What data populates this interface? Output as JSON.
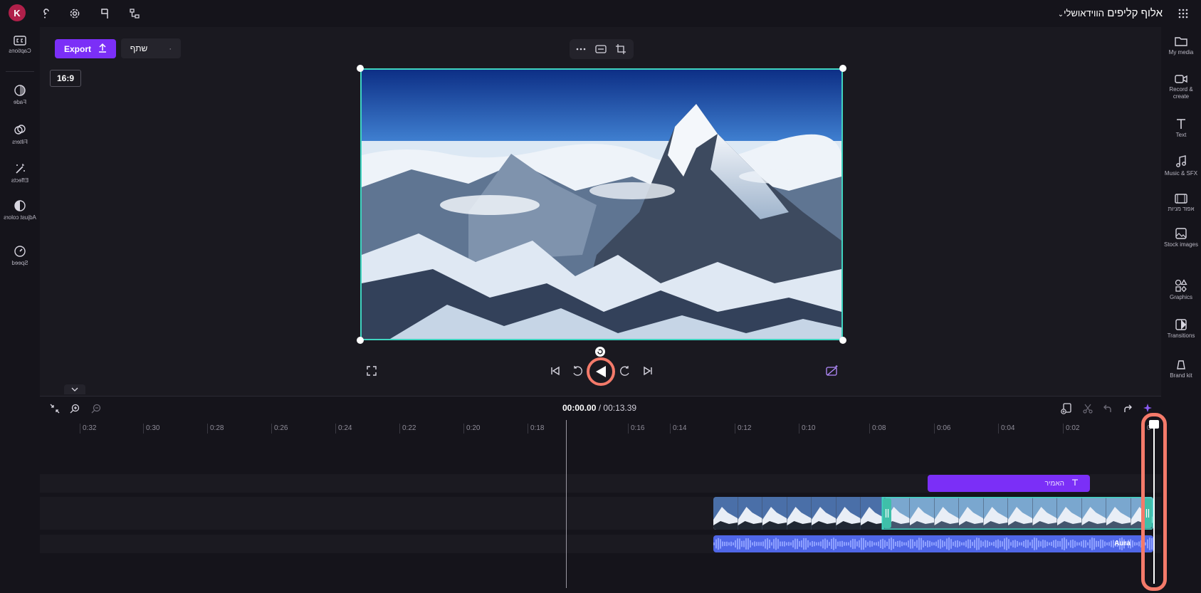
{
  "header": {
    "title": "אלוף קליפים",
    "library_label": "הווידאושלי",
    "avatar_initial": "K"
  },
  "left_rail": [
    {
      "label": "Captions",
      "icon": "captions-icon"
    },
    {
      "label": "Fade",
      "icon": "fade-icon"
    },
    {
      "label": "Filters",
      "icon": "filters-icon"
    },
    {
      "label": "Effects",
      "icon": "effects-icon"
    },
    {
      "label": "Adjust colors",
      "icon": "adjust-colors-icon"
    },
    {
      "label": "Speed",
      "icon": "speed-icon"
    }
  ],
  "right_rail": [
    {
      "label": "My media",
      "icon": "folder-icon"
    },
    {
      "label": "Record & create",
      "icon": "camera-icon"
    },
    {
      "label": "Text",
      "icon": "text-icon"
    },
    {
      "label": "Music & SFX",
      "icon": "music-icon"
    },
    {
      "label": "אפוד מניות",
      "icon": "film-icon"
    },
    {
      "label": "Stock images",
      "icon": "image-icon"
    },
    {
      "label": "Graphics",
      "icon": "shapes-icon"
    },
    {
      "label": "Transitions",
      "icon": "transitions-icon"
    },
    {
      "label": "Brand kit",
      "icon": "brand-kit-icon"
    }
  ],
  "stage": {
    "export_label": "Export",
    "share_label": "שתף",
    "share_dot": "·",
    "aspect_ratio": "16:9"
  },
  "timeline": {
    "current_time": "00:00.00",
    "separator": " / ",
    "total_time": "00:13.39",
    "ruler_ticks": [
      "0:32",
      "0:30",
      "0:28",
      "0:26",
      "0:24",
      "0:22",
      "0:20",
      "0:18",
      "0:16",
      "0:14",
      "0:12",
      "0:10",
      "0:08",
      "0:06",
      "0:04",
      "0:02",
      "0"
    ],
    "text_clip_label": "האמיר",
    "audio_clip_label": "Aura"
  },
  "colors": {
    "accent": "#7b2ff7",
    "highlight": "#f47a6a",
    "selection": "#3fd4c0",
    "audio": "#5067e8"
  }
}
